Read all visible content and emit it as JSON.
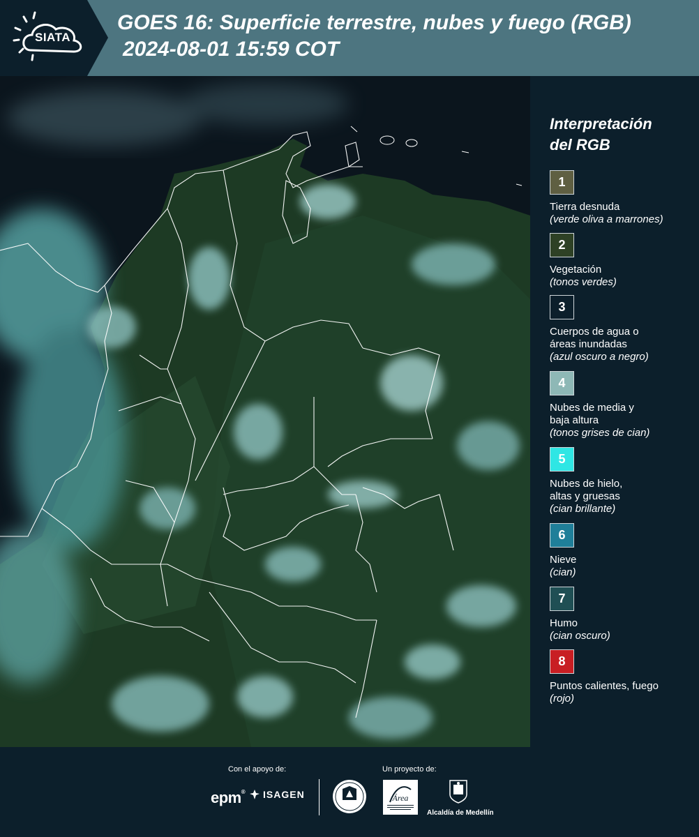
{
  "header": {
    "logo_text": "SIATA",
    "title": "GOES 16: Superficie terrestre, nubes y fuego (RGB)",
    "datetime": "2024-08-01 15:59 COT"
  },
  "legend": {
    "title_line1": "Interpretación",
    "title_line2": "del RGB",
    "items": [
      {
        "number": "1",
        "label_lines": [
          "Tierra desnuda"
        ],
        "sub": "(verde oliva a marrones)",
        "color": "#5f5f42"
      },
      {
        "number": "2",
        "label_lines": [
          "Vegetación"
        ],
        "sub": "(tonos verdes)",
        "color": "#2e4125"
      },
      {
        "number": "3",
        "label_lines": [
          "Cuerpos de agua o",
          "áreas inundadas"
        ],
        "sub": "(azul oscuro a negro)",
        "color": "#0c1f2b"
      },
      {
        "number": "4",
        "label_lines": [
          "Nubes de media y",
          "baja altura"
        ],
        "sub": "(tonos grises de cian)",
        "color": "#8eb8b6"
      },
      {
        "number": "5",
        "label_lines": [
          "Nubes de hielo,",
          "altas y gruesas"
        ],
        "sub": "(cian brillante)",
        "color": "#2fe6e4"
      },
      {
        "number": "6",
        "label_lines": [
          "Nieve"
        ],
        "sub": "(cian)",
        "color": "#1f7f99"
      },
      {
        "number": "7",
        "label_lines": [
          "Humo"
        ],
        "sub": "(cian oscuro)",
        "color": "#1f4f54"
      },
      {
        "number": "8",
        "label_lines": [
          "Puntos calientes, fuego"
        ],
        "sub": "(rojo)",
        "color": "#c81e23"
      }
    ]
  },
  "footer": {
    "support_label": "Con el apoyo de:",
    "project_label": "Un proyecto de:",
    "sponsor_1": "epm",
    "sponsor_2": "ISAGEN",
    "area_logo_text": "Área METROPOLITANA Valle de Aburrá",
    "alcaldia": "Alcaldía de Medellín"
  },
  "colors": {
    "header_bg": "#4d7580",
    "panel_bg": "#0c1f2b",
    "border_lines": "#ffffff"
  }
}
